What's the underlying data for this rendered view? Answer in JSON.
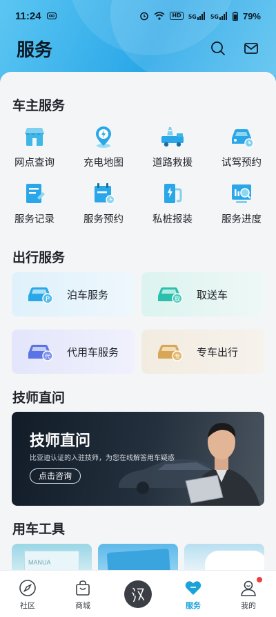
{
  "status_bar": {
    "time": "11:24",
    "battery": "79%",
    "hd_label": "HD",
    "sim_label_1": "5G",
    "sim_label_2": "5G"
  },
  "header": {
    "title": "服务"
  },
  "owner_services": {
    "title": "车主服务",
    "items": [
      {
        "label": "网点查询",
        "icon": "store-icon"
      },
      {
        "label": "充电地图",
        "icon": "charging-map-icon"
      },
      {
        "label": "道路救援",
        "icon": "tow-truck-icon"
      },
      {
        "label": "试驾预约",
        "icon": "test-drive-icon"
      },
      {
        "label": "服务记录",
        "icon": "service-record-icon"
      },
      {
        "label": "服务预约",
        "icon": "service-booking-icon"
      },
      {
        "label": "私桩报装",
        "icon": "private-charger-icon"
      },
      {
        "label": "服务进度",
        "icon": "service-progress-icon"
      }
    ]
  },
  "travel_services": {
    "title": "出行服务",
    "items": [
      {
        "label": "泊车服务",
        "badge": "P"
      },
      {
        "label": "取送车",
        "badge": "取"
      },
      {
        "label": "代用车服务",
        "badge": "代"
      },
      {
        "label": "专车出行",
        "badge": "专"
      }
    ]
  },
  "technician": {
    "title": "技师直问",
    "banner_title": "技师直问",
    "banner_subtitle": "比亚迪认证的入驻技师，为您在线解答用车疑惑",
    "banner_button": "点击咨询"
  },
  "tools": {
    "title": "用车工具",
    "manual_text": "MANUA"
  },
  "tab_bar": {
    "items": [
      {
        "label": "社区",
        "icon": "compass-icon"
      },
      {
        "label": "商城",
        "icon": "shopping-bag-icon"
      },
      {
        "label": "",
        "icon": "han-logo-icon"
      },
      {
        "label": "服务",
        "icon": "heart-icon",
        "active": true
      },
      {
        "label": "我的",
        "icon": "profile-icon"
      }
    ],
    "active_color": "#1aa3d9"
  },
  "colors": {
    "accent": "#1aa3d9",
    "notification_dot": "#f03c3c"
  }
}
